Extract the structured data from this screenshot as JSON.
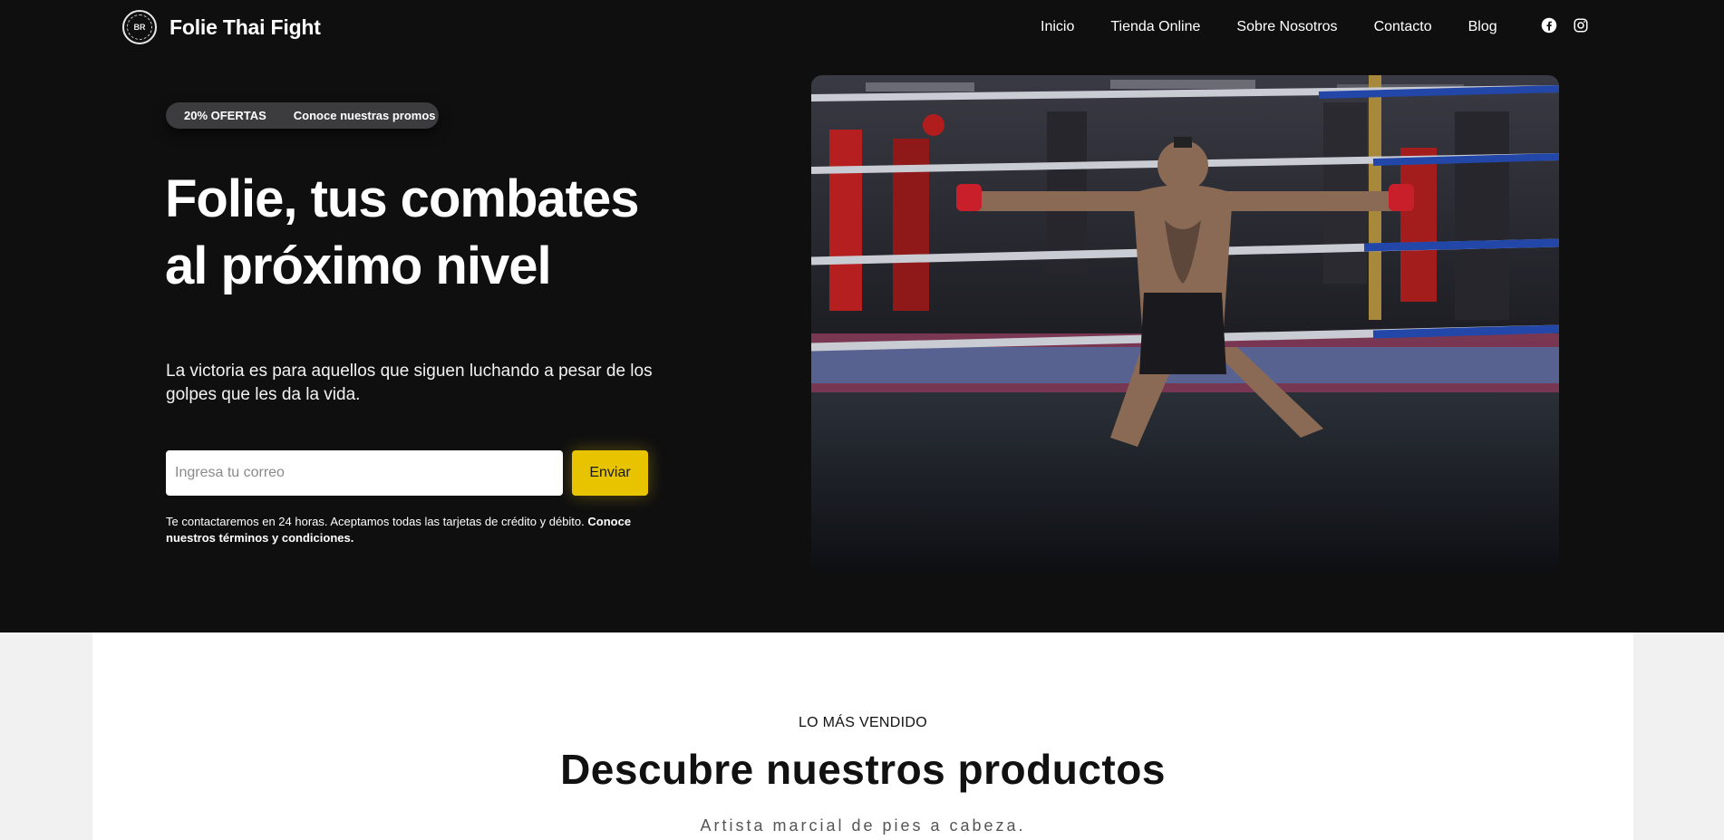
{
  "brand": {
    "name": "Folie Thai Fight",
    "logo_text": "BR"
  },
  "nav": {
    "items": [
      {
        "label": "Inicio"
      },
      {
        "label": "Tienda Online"
      },
      {
        "label": "Sobre Nosotros"
      },
      {
        "label": "Contacto"
      },
      {
        "label": "Blog"
      }
    ],
    "social": [
      {
        "icon": "facebook-icon"
      },
      {
        "icon": "instagram-icon"
      }
    ]
  },
  "hero": {
    "promo": {
      "tag": "20% OFERTAS",
      "link": "Conoce nuestras promos"
    },
    "headline_line1": "Folie, tus combates",
    "headline_line2": "al próximo nivel",
    "subtext": "La victoria es para aquellos que siguen luchando a pesar de los golpes que les da la vida.",
    "email_placeholder": "Ingresa tu correo",
    "email_value": "",
    "submit_label": "Enviar",
    "legal_text": "Te contactaremos en 24 horas. Aceptamos todas las tarjetas de crédito y débito. ",
    "legal_link": "Conoce nuestros términos y condiciones."
  },
  "products": {
    "eyebrow": "LO MÁS VENDIDO",
    "title": "Descubre nuestros productos",
    "subtitle": "Artista marcial de pies a cabeza."
  },
  "colors": {
    "accent": "#e8c400",
    "hero_bg": "#0f0f10",
    "page_bg": "#f1f1f1"
  }
}
